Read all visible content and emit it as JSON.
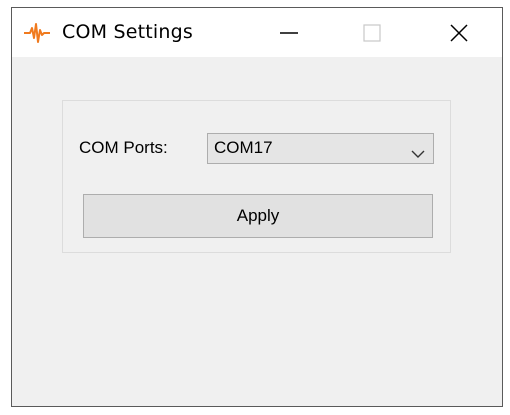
{
  "window": {
    "title": "COM Settings",
    "app_icon": "waveform-icon",
    "controls": [
      "minimize-icon",
      "maximize-icon",
      "close-icon"
    ]
  },
  "form": {
    "com_ports_label": "COM Ports:",
    "com_ports_selected": "COM17",
    "apply_label": "Apply"
  },
  "colors": {
    "window_bg": "#f0f0f0",
    "titlebar_bg": "#ffffff",
    "icon_accent": "#f07a1e",
    "border": "#5a5a5a"
  }
}
